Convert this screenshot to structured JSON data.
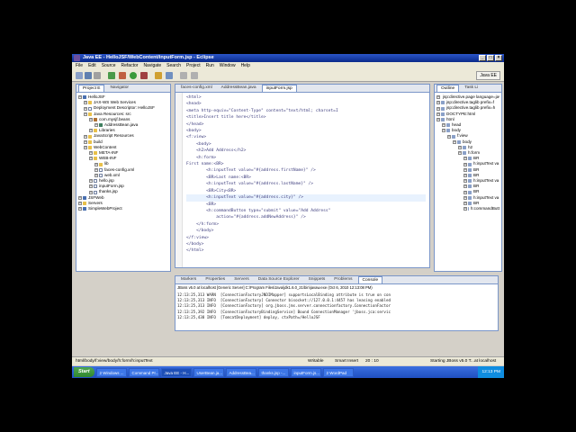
{
  "window": {
    "title": "Java EE - HelloJSF/WebContent/inputForm.jsp - Eclipse"
  },
  "menu": [
    "File",
    "Edit",
    "Source",
    "Refactor",
    "Navigate",
    "Search",
    "Project",
    "Run",
    "Window",
    "Help"
  ],
  "perspective": {
    "label": "Java EE"
  },
  "left_panel": {
    "tabs": [
      "Project E",
      "Navigator"
    ],
    "tree": [
      {
        "label": "HelloJSF",
        "depth": 0,
        "icon": "proj"
      },
      {
        "label": "JAX-WS Web Services",
        "depth": 1,
        "icon": "folder"
      },
      {
        "label": "Deployment Descriptor: HelloJSF",
        "depth": 1,
        "icon": "file"
      },
      {
        "label": "Java Resources: src",
        "depth": 1,
        "icon": "folder"
      },
      {
        "label": "com.mysjf.beans",
        "depth": 2,
        "icon": "pkg"
      },
      {
        "label": "AddressBean.java",
        "depth": 3,
        "icon": "java"
      },
      {
        "label": "Libraries",
        "depth": 2,
        "icon": "folder"
      },
      {
        "label": "JavaScript Resources",
        "depth": 1,
        "icon": "folder"
      },
      {
        "label": "build",
        "depth": 1,
        "icon": "folder"
      },
      {
        "label": "WebContent",
        "depth": 1,
        "icon": "folder"
      },
      {
        "label": "META-INF",
        "depth": 2,
        "icon": "folder"
      },
      {
        "label": "WEB-INF",
        "depth": 2,
        "icon": "folder"
      },
      {
        "label": "lib",
        "depth": 3,
        "icon": "folder"
      },
      {
        "label": "faces-config.xml",
        "depth": 3,
        "icon": "file"
      },
      {
        "label": "web.xml",
        "depth": 3,
        "icon": "file"
      },
      {
        "label": "hello.jsp",
        "depth": 2,
        "icon": "file"
      },
      {
        "label": "inputForm.jsp",
        "depth": 2,
        "icon": "file"
      },
      {
        "label": "thanks.jsp",
        "depth": 2,
        "icon": "file"
      },
      {
        "label": "JSFWeb",
        "depth": 0,
        "icon": "proj"
      },
      {
        "label": "Servers",
        "depth": 0,
        "icon": "folder"
      },
      {
        "label": "SimpleWebProject",
        "depth": 0,
        "icon": "proj"
      }
    ]
  },
  "editor": {
    "tabs": [
      "faces-config.xml",
      "AddressBean.java",
      "inputForm.jsp"
    ],
    "lines": [
      "<html>",
      "<head>",
      "<meta http-equiv=\"Content-Type\" content=\"text/html; charset=I",
      "<title>Insert title here</title>",
      "</head>",
      "<body>",
      "<f:view>",
      "    <body>",
      "    <h2>Add Address</h2>",
      "    <h:form>",
      "First name:<BR>",
      "        <h:inputText value=\"#{address.firstName}\" />",
      "        <BR>Last name:<BR>",
      "        <h:inputText value=\"#{address.lastName}\" />",
      "        <BR>City<BR>",
      "        <h:inputText value=\"#{address.city}\" />",
      "        <BR>",
      "        <h:commandButton type=\"submit\" value=\"Add Address\"",
      "            action=\"#{address.addNewAddress}\" />",
      "    </h:form>",
      "    </body>",
      "</f:view>",
      "</body>",
      "</html>"
    ]
  },
  "outline": {
    "tabs": [
      "Outline",
      "Task Li"
    ],
    "tree": [
      {
        "label": "jsp:directive.page language=java",
        "depth": 0
      },
      {
        "label": "jsp:directive.taglib prefix=f",
        "depth": 0
      },
      {
        "label": "jsp:directive.taglib prefix=h",
        "depth": 0
      },
      {
        "label": "DOCTYPE:html",
        "depth": 0
      },
      {
        "label": "html",
        "depth": 0
      },
      {
        "label": "head",
        "depth": 1
      },
      {
        "label": "body",
        "depth": 1
      },
      {
        "label": "f:view",
        "depth": 2
      },
      {
        "label": "body",
        "depth": 3
      },
      {
        "label": "h2",
        "depth": 4
      },
      {
        "label": "h:form",
        "depth": 4
      },
      {
        "label": "BR",
        "depth": 5
      },
      {
        "label": "h:inputText va",
        "depth": 5
      },
      {
        "label": "BR",
        "depth": 5
      },
      {
        "label": "BR",
        "depth": 5
      },
      {
        "label": "h:inputText va",
        "depth": 5
      },
      {
        "label": "BR",
        "depth": 5
      },
      {
        "label": "BR",
        "depth": 5
      },
      {
        "label": "h:inputText va",
        "depth": 5
      },
      {
        "label": "BR",
        "depth": 5
      },
      {
        "label": "h:commandButt",
        "depth": 5
      }
    ]
  },
  "bottom": {
    "tabs": [
      "Markers",
      "Properties",
      "Servers",
      "Data Source Explorer",
      "Snippets",
      "Problems",
      "Console"
    ],
    "console_header": "JBoss v5.0 at localhost [Generic Server] C:\\Program Files\\Java\\jdk1.6.0_21\\bin\\javaw.exe (Oct 6, 2010 12:13:08 PM)",
    "console_lines": [
      "12:13:25,313 WARN  [ConnectionFactoryJNDIMapper] supportsLocalBinding attribute is true on con",
      "12:13:25,313 INFO  [ConnectionFactory] Connector bisocket://127.0.0.1:4457 has leasing enabled",
      "12:13:25,313 INFO  [ConnectionFactory] org.jboss.jms.server.connectionfactory.ConnectionFactor",
      "12:13:25,392 INFO  [ConnectionFactoryBindingService] Bound ConnectionManager 'jboss.jca:servic",
      "12:13:25,438 INFO  [TomcatDeployment] deploy, ctxPath=/HelloJSF"
    ]
  },
  "status": {
    "path": "html/body/f:view/body/h:form/h:inputText",
    "mode": "Writable",
    "insert": "Smart Insert",
    "position": "20 : 10",
    "server": "Starting JBoss v5.0 T...at localhost"
  },
  "taskbar": {
    "start": "Start",
    "tasks": [
      "2 Windows ...",
      "Command Pr...",
      "Java EE - H...",
      "UserBean.ja...",
      "AddressBea...",
      "thanks.jsp -...",
      "inputForm.js...",
      "2 WordPad"
    ],
    "clock": "12:13 PM"
  }
}
